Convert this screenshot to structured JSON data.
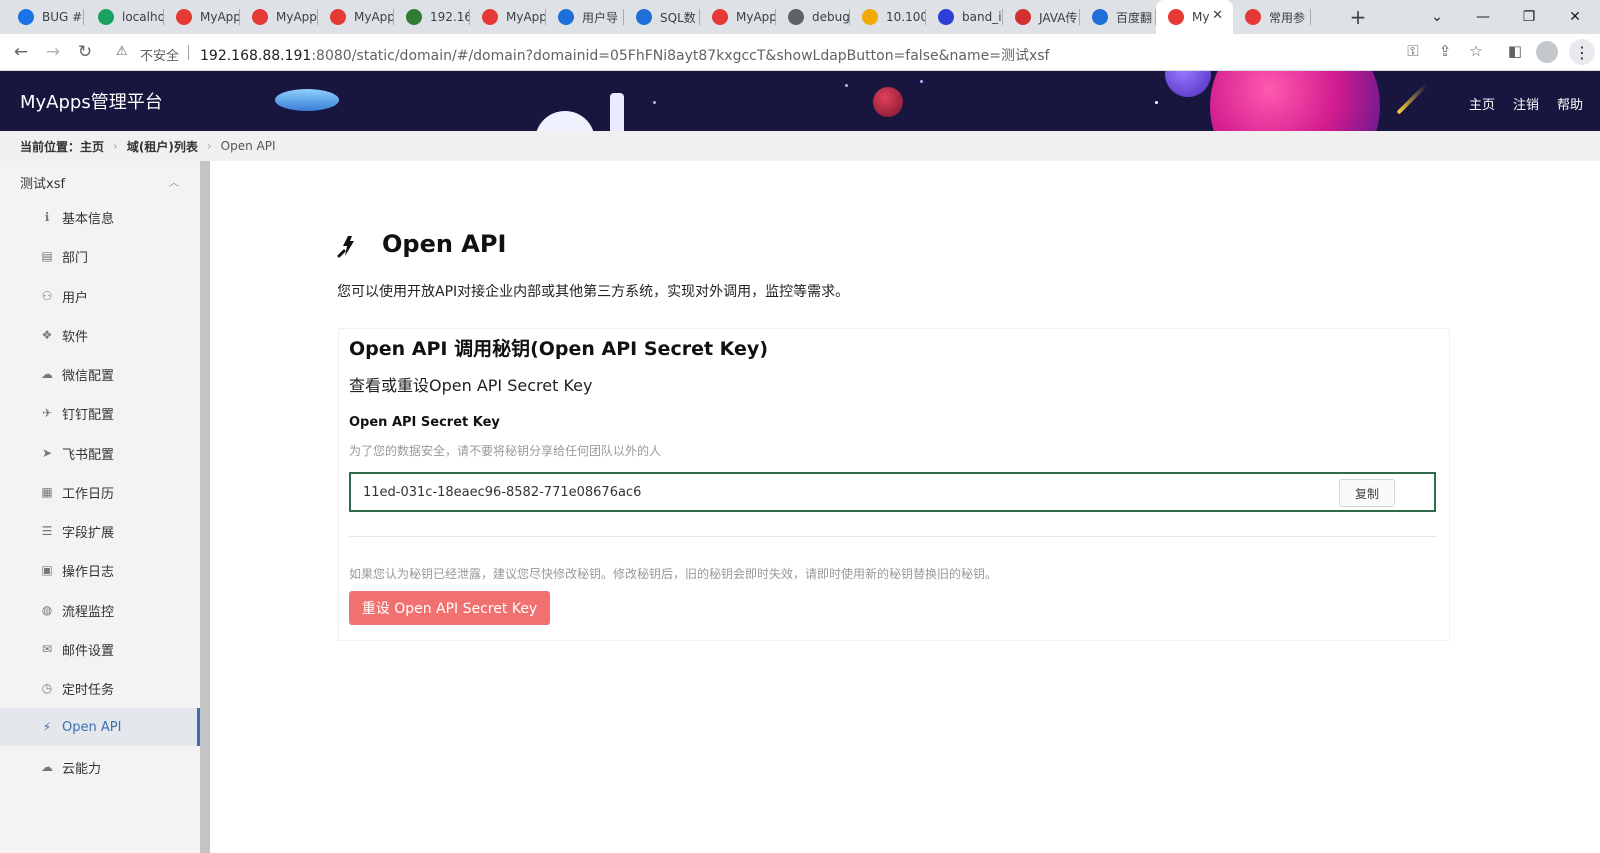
{
  "browser": {
    "tabs": [
      {
        "title": "BUG #",
        "icon": "chrome-circle-icon",
        "color": "#1a73e8"
      },
      {
        "title": "localho",
        "icon": "home-icon",
        "color": "#1aa260"
      },
      {
        "title": "MyApp",
        "icon": "myapps-icon",
        "color": "#e53935"
      },
      {
        "title": "MyApp",
        "icon": "myapps-icon",
        "color": "#e53935"
      },
      {
        "title": "MyApp",
        "icon": "myapps-icon",
        "color": "#e53935"
      },
      {
        "title": "192.16",
        "icon": "vue-icon",
        "color": "#2e7d32"
      },
      {
        "title": "MyApp",
        "icon": "myapps-icon",
        "color": "#e53935"
      },
      {
        "title": "用户导",
        "icon": "doc-icon",
        "color": "#1e6fd9"
      },
      {
        "title": "SQL数",
        "icon": "doc-icon",
        "color": "#1e6fd9"
      },
      {
        "title": "MyApp",
        "icon": "myapps-icon",
        "color": "#e53935"
      },
      {
        "title": "debug",
        "icon": "globe-icon",
        "color": "#5f6368"
      },
      {
        "title": "10.100",
        "icon": "coin-icon",
        "color": "#f2a900"
      },
      {
        "title": "band_i",
        "icon": "paw-icon",
        "color": "#2b3fd6"
      },
      {
        "title": "JAVA传",
        "icon": "java-icon",
        "color": "#d32f2f"
      },
      {
        "title": "百度翻",
        "icon": "translate-icon",
        "color": "#1e6fd9"
      },
      {
        "title": "My",
        "icon": "myapps-icon",
        "color": "#e53935"
      },
      {
        "title": "常用参",
        "icon": "bookmark-icon",
        "color": "#e53935"
      }
    ],
    "new_tab": "+",
    "insecure_label": "不安全",
    "url_host": "192.168.88.191",
    "url_rest": ":8080/static/domain/#/domain?domainid=05FhFNi8ayt87kxgccT&showLdapButton=false&name=测试xsf"
  },
  "header": {
    "app_title": "MyApps管理平台",
    "links": [
      "主页",
      "注销",
      "帮助"
    ]
  },
  "breadcrumb": {
    "label": "当前位置：",
    "items": [
      "主页",
      "域(租户)列表",
      "Open API"
    ]
  },
  "sidebar": {
    "group_title": "测试xsf",
    "items": [
      {
        "label": "基本信息",
        "icon": "info-icon",
        "glyph": "ℹ"
      },
      {
        "label": "部门",
        "icon": "building-icon",
        "glyph": "▤"
      },
      {
        "label": "用户",
        "icon": "user-icon",
        "glyph": "⚇"
      },
      {
        "label": "软件",
        "icon": "cubes-icon",
        "glyph": "❖"
      },
      {
        "label": "微信配置",
        "icon": "wechat-icon",
        "glyph": "☁"
      },
      {
        "label": "钉钉配置",
        "icon": "plane-icon",
        "glyph": "✈"
      },
      {
        "label": "飞书配置",
        "icon": "paper-plane-icon",
        "glyph": "➤"
      },
      {
        "label": "工作日历",
        "icon": "calendar-icon",
        "glyph": "▦"
      },
      {
        "label": "字段扩展",
        "icon": "sliders-icon",
        "glyph": "☰"
      },
      {
        "label": "操作日志",
        "icon": "log-icon",
        "glyph": "▣"
      },
      {
        "label": "流程监控",
        "icon": "dashboard-icon",
        "glyph": "◍"
      },
      {
        "label": "邮件设置",
        "icon": "envelope-icon",
        "glyph": "✉"
      },
      {
        "label": "定时任务",
        "icon": "clock-icon",
        "glyph": "◷"
      },
      {
        "label": "Open API",
        "icon": "plug-icon",
        "glyph": "⚡"
      },
      {
        "label": "云能力",
        "icon": "cloud-icon",
        "glyph": "☁"
      }
    ],
    "active_index": 13
  },
  "main": {
    "title": "Open API",
    "description": "您可以使用开放API对接企业内部或其他第三方系统，实现对外调用，监控等需求。",
    "card": {
      "title": "Open API 调用秘钥(Open API Secret Key)",
      "subtitle": "查看或重设Open API Secret Key",
      "key_label": "Open API Secret Key",
      "key_hint": "为了您的数据安全，请不要将秘钥分享给任何团队以外的人",
      "key_value": "11ed-031c-18eaec96-8582-771e08676ac6",
      "copy_label": "复制",
      "warning": "如果您认为秘钥已经泄露，建议您尽快修改秘钥。修改秘钥后，旧的秘钥会即时失效，请即时使用新的秘钥替换旧的秘钥。",
      "reset_label": "重设 Open API Secret Key"
    }
  },
  "colors": {
    "header_bg": "#18163f",
    "active_menu": "#3a6fb0",
    "key_border": "#2f6b4a",
    "danger_button": "#f17171"
  }
}
